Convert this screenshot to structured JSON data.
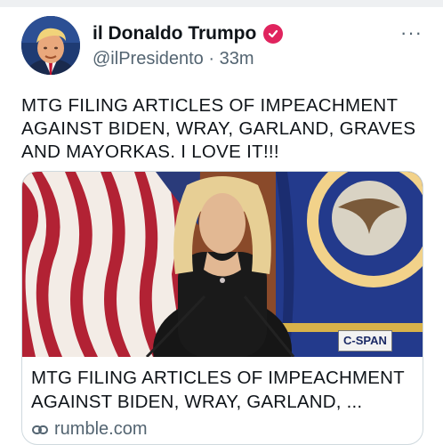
{
  "author": {
    "display_name": "il Donaldo Trumpo",
    "handle": "@ilPresidento",
    "separator": "·",
    "time": "33m"
  },
  "menu": {
    "more_label": "···"
  },
  "tweet": {
    "text": "MTG FILING ARTICLES OF IMPEACHMENT AGAINST BIDEN, WRAY, GARLAND, GRAVES AND MAYORKAS. I LOVE IT!!!"
  },
  "card": {
    "title": "MTG FILING ARTICLES OF IMPEACHMENT AGAINST BIDEN, WRAY, GARLAND, ...",
    "domain": "rumble.com",
    "watermark": "C-SPAN"
  },
  "colors": {
    "verified_badge": "#e0245e",
    "secondary_text": "#536471",
    "card_border": "#cfd9de"
  },
  "icons": [
    "verified-badge-icon",
    "more-options-icon",
    "link-icon"
  ]
}
